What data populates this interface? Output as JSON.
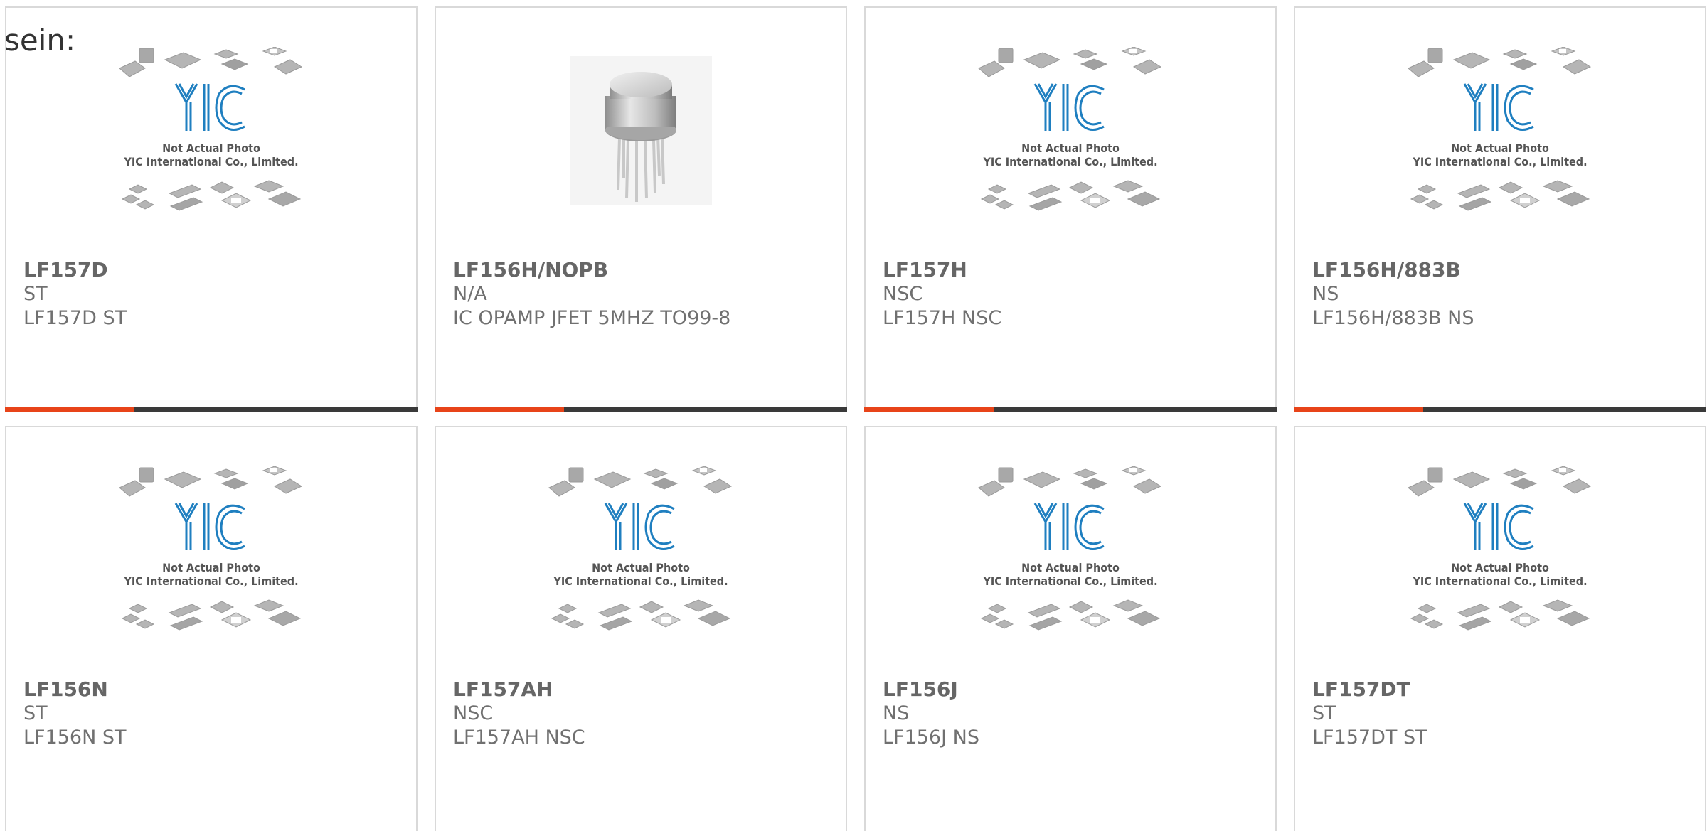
{
  "heading": "sein:",
  "placeholder": {
    "line1": "Not Actual Photo",
    "line2": "YIC International Co., Limited.",
    "logo": "YIC"
  },
  "colors": {
    "accent": "#e84419",
    "bar": "#3a3a3a",
    "logo_blue": "#1f7fc0",
    "border": "#d9d9d9"
  },
  "products": [
    {
      "part": "LF157D",
      "manufacturer": "ST",
      "description": "LF157D ST",
      "image": "placeholder"
    },
    {
      "part": "LF156H/NOPB",
      "manufacturer": "N/A",
      "description": "IC OPAMP JFET 5MHZ TO99-8",
      "image": "to99-can-photo"
    },
    {
      "part": "LF157H",
      "manufacturer": "NSC",
      "description": "LF157H NSC",
      "image": "placeholder"
    },
    {
      "part": "LF156H/883B",
      "manufacturer": "NS",
      "description": "LF156H/883B NS",
      "image": "placeholder"
    },
    {
      "part": "LF156N",
      "manufacturer": "ST",
      "description": "LF156N ST",
      "image": "placeholder"
    },
    {
      "part": "LF157AH",
      "manufacturer": "NSC",
      "description": "LF157AH NSC",
      "image": "placeholder"
    },
    {
      "part": "LF156J",
      "manufacturer": "NS",
      "description": "LF156J NS",
      "image": "placeholder"
    },
    {
      "part": "LF157DT",
      "manufacturer": "ST",
      "description": "LF157DT ST",
      "image": "placeholder"
    }
  ]
}
